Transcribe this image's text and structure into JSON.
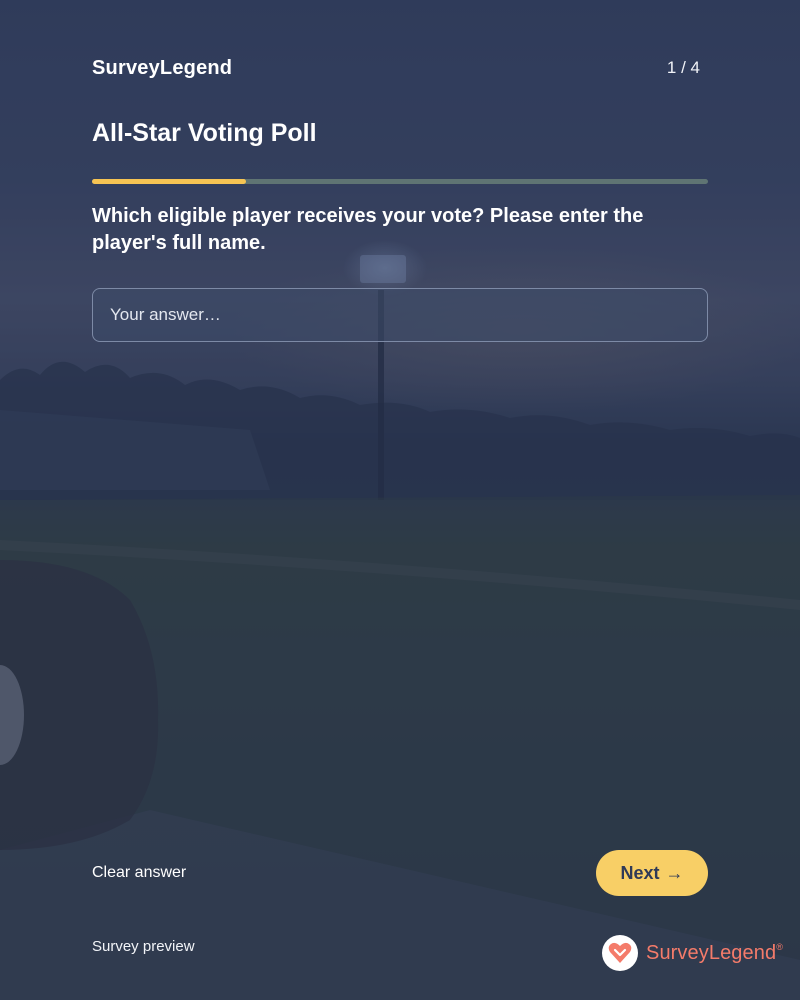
{
  "header": {
    "brand": "SurveyLegend",
    "step_counter": "1 / 4"
  },
  "survey": {
    "title": "All-Star Voting Poll",
    "progress": 0.25,
    "question": "Which eligible player receives your vote? Please enter the player's full name.",
    "answer_value": "",
    "answer_placeholder": "Your answer…"
  },
  "actions": {
    "clear_label": "Clear answer",
    "next_label": "Next",
    "next_arrow": "→"
  },
  "footer": {
    "preview_label": "Survey preview",
    "logo_text": "SurveyLegend",
    "logo_reg": "®"
  },
  "colors": {
    "accent": "#f6c453",
    "button": "#f8cf66",
    "logo": "#f47b6a",
    "background": "#2f3a57"
  }
}
